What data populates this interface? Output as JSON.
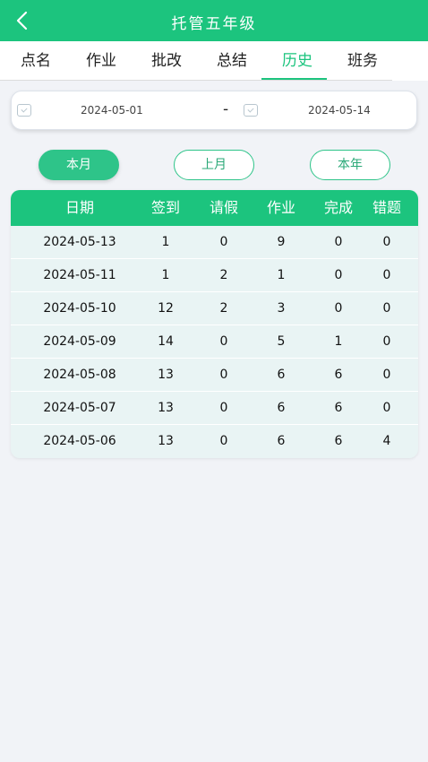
{
  "header": {
    "title": "托管五年级",
    "back_icon": "back-arrow-icon"
  },
  "tabs": [
    {
      "label": "点名",
      "active": false
    },
    {
      "label": "作业",
      "active": false
    },
    {
      "label": "批改",
      "active": false
    },
    {
      "label": "总结",
      "active": false
    },
    {
      "label": "历史",
      "active": true
    },
    {
      "label": "班务",
      "active": false
    }
  ],
  "date_range": {
    "start": "2024-05-01",
    "separator": "-",
    "end": "2024-05-14"
  },
  "period_buttons": [
    {
      "label": "本月",
      "active": true
    },
    {
      "label": "上月",
      "active": false
    },
    {
      "label": "本年",
      "active": false
    }
  ],
  "table": {
    "headers": [
      "日期",
      "签到",
      "请假",
      "作业",
      "完成",
      "错题"
    ],
    "rows": [
      [
        "2024-05-13",
        "1",
        "0",
        "9",
        "0",
        "0"
      ],
      [
        "2024-05-11",
        "1",
        "2",
        "1",
        "0",
        "0"
      ],
      [
        "2024-05-10",
        "12",
        "2",
        "3",
        "0",
        "0"
      ],
      [
        "2024-05-09",
        "14",
        "0",
        "5",
        "1",
        "0"
      ],
      [
        "2024-05-08",
        "13",
        "0",
        "6",
        "6",
        "0"
      ],
      [
        "2024-05-07",
        "13",
        "0",
        "6",
        "6",
        "0"
      ],
      [
        "2024-05-06",
        "13",
        "0",
        "6",
        "6",
        "4"
      ]
    ]
  },
  "colors": {
    "accent": "#1cc47e",
    "pill_active": "#2ec489",
    "row_bg": "#e9f4f4",
    "page_bg": "#f1f3f7"
  }
}
